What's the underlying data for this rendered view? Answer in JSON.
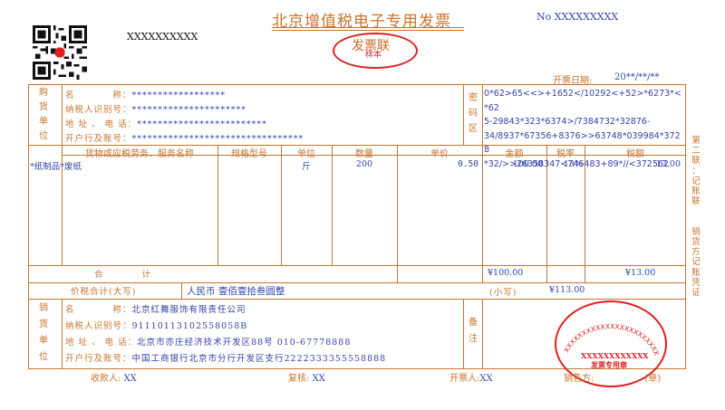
{
  "invoice": {
    "title": "北京增值税电子专用发票",
    "number_label": "No",
    "number_value": "XXXXXXXXX",
    "code": "XXXXXXXXXX",
    "copy_name": "发票联",
    "sample_mark": "样本",
    "date_label": "开票日期:",
    "date_value": "20**/**/**"
  },
  "buyer": {
    "side_label": [
      "购",
      "货",
      "单",
      "位"
    ],
    "name_label": "名　　　　称：",
    "name_value": "******************",
    "taxid_label": "纳税人识别号：",
    "taxid_value": "**********************",
    "address_label": "地 址 、 电 话：",
    "address_value": "*************************",
    "bank_label": "开户行及账号：",
    "bank_value": "*********************************"
  },
  "cipher": {
    "side_label": [
      "密",
      "码",
      "区"
    ],
    "lines": [
      "0*62>65<<>+1652</10292<+52>*6273*<*62",
      "5-29843*323*6374>/7384732*32876-",
      "34/8937*67356+8376>>63748*039984*3728",
      "*32/>>26358347<746483+89*//<372562"
    ]
  },
  "items": {
    "headers": {
      "name": "货物或应税劳务、服务名称",
      "spec": "规格型号",
      "unit": "单位",
      "qty": "数量",
      "price": "单价",
      "amount": "金额",
      "rate": "税率",
      "tax": "税额"
    },
    "rows": [
      {
        "name": "*纸制品*废纸",
        "spec": "",
        "unit": "斤",
        "qty": "200",
        "price": "0.50",
        "amount": "100.00",
        "rate": "13%",
        "tax": "13.00"
      }
    ],
    "total_label": "合　　　　计",
    "total_amount": "¥100.00",
    "total_tax": "¥13.00"
  },
  "grand_total": {
    "label": "价税合计(大写)",
    "currency_icon": "circled-x-icon",
    "upper_text": "人民币 壹佰壹拾叁圆整",
    "small_label": "(小写)",
    "small_value": "¥113.00"
  },
  "seller": {
    "side_label": [
      "销",
      "货",
      "单",
      "位"
    ],
    "name_label": "名　　　　称：",
    "name_value": "北京红舞服饰有限责任公司",
    "taxid_label": "纳税人识别号：",
    "taxid_value": "91110113102558058B",
    "address_label": "地 址 、 电 话：",
    "address_value": "北京市亦庄经济技术开发区88号 010-67778888",
    "bank_label": "开户行及账号：",
    "bank_value": "中国工商银行北京市分行开发区支行2222333355558888"
  },
  "remarks": {
    "side_label": [
      "备",
      "注"
    ]
  },
  "seal": {
    "arc_text": "XXXXXXXXXXXXXXXXXXXXXXX",
    "code": "XXXXXXXXXXXX",
    "name": "发票专用章"
  },
  "right_margin": [
    "第",
    "二",
    "联",
    "：",
    "记",
    "账",
    "联",
    "",
    "",
    "销",
    "货",
    "方",
    "记",
    "账",
    "凭",
    "证"
  ],
  "footer": {
    "payee_label": "收款人:",
    "payee_value": "XX",
    "reviewer_label": "复核:",
    "reviewer_value": "XX",
    "drawer_label": "开票人:",
    "drawer_value": "XX",
    "seller_label": "销售方:",
    "seller_suffix": "(章)"
  },
  "colors": {
    "frame": "#c8742c",
    "content": "#3344aa",
    "stamp": "#e02020"
  }
}
